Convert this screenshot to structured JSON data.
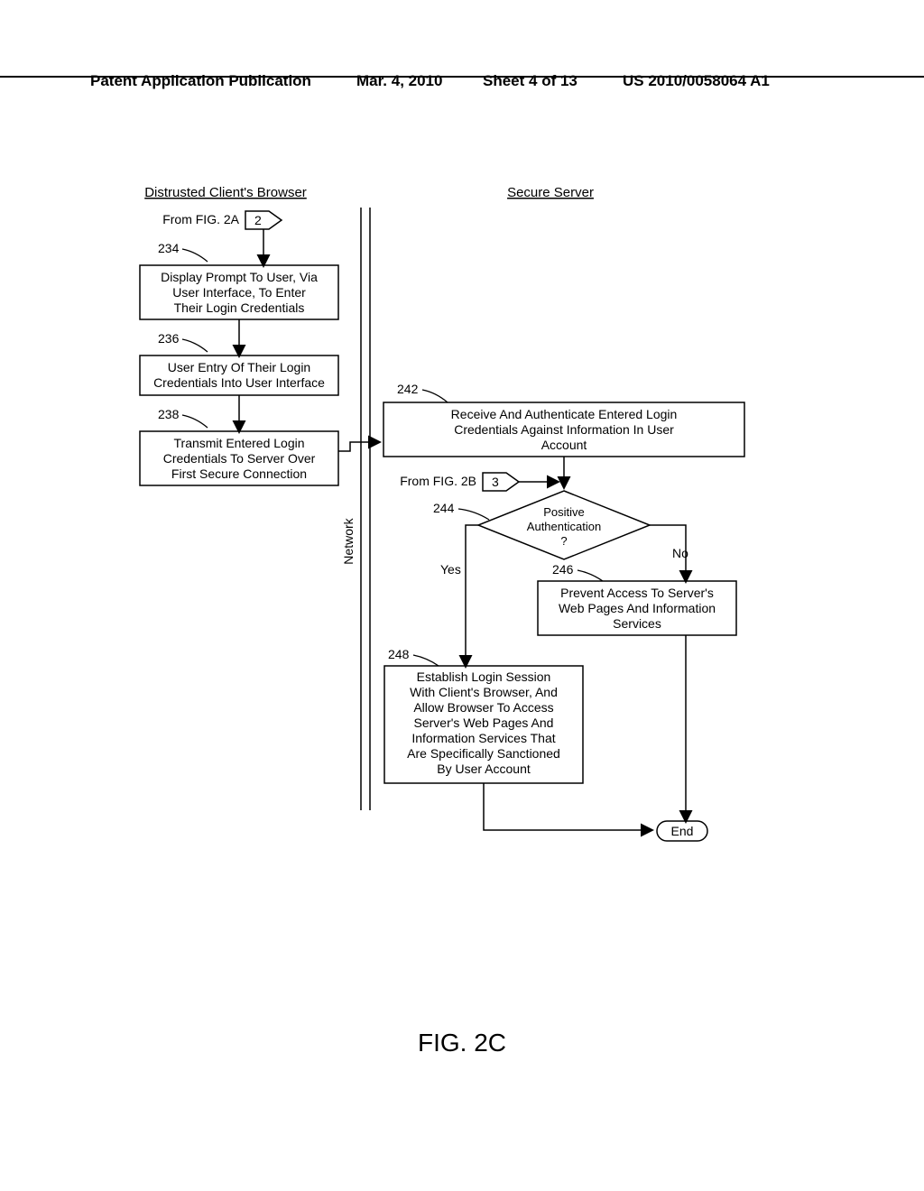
{
  "header": {
    "left": "Patent Application Publication",
    "date": "Mar. 4, 2010",
    "sheet": "Sheet 4 of 13",
    "pubno": "US 2010/0058064 A1"
  },
  "figure_label": "FIG. 2C",
  "titles": {
    "left_lane": "Distrusted Client's Browser",
    "right_lane": "Secure Server"
  },
  "from_labels": {
    "fig2a": "From FIG. 2A",
    "fig2a_num": "2",
    "fig2b": "From FIG. 2B",
    "fig2b_num": "3"
  },
  "refnums": {
    "r234": "234",
    "r236": "236",
    "r238": "238",
    "r242": "242",
    "r244": "244",
    "r246": "246",
    "r248": "248"
  },
  "boxes": {
    "b234": {
      "l1": "Display Prompt To User, Via",
      "l2": "User Interface, To Enter",
      "l3": "Their Login Credentials"
    },
    "b236": {
      "l1": "User Entry Of Their Login",
      "l2": "Credentials Into User Interface"
    },
    "b238": {
      "l1": "Transmit Entered Login",
      "l2": "Credentials To Server Over",
      "l3": "First Secure Connection"
    },
    "b242": {
      "l1": "Receive And Authenticate Entered Login",
      "l2": "Credentials Against Information In User",
      "l3": "Account"
    },
    "b244": {
      "l1": "Positive",
      "l2": "Authentication",
      "l3": "?"
    },
    "b246": {
      "l1": "Prevent Access To Server's",
      "l2": "Web Pages And Information",
      "l3": "Services"
    },
    "b248": {
      "l1": "Establish Login Session",
      "l2": "With Client's Browser, And",
      "l3": "Allow Browser To Access",
      "l4": "Server's Web Pages And",
      "l5": "Information Services That",
      "l6": "Are Specifically Sanctioned",
      "l7": "By User Account"
    }
  },
  "branches": {
    "yes": "Yes",
    "no": "No"
  },
  "network": "Network",
  "end": "End"
}
